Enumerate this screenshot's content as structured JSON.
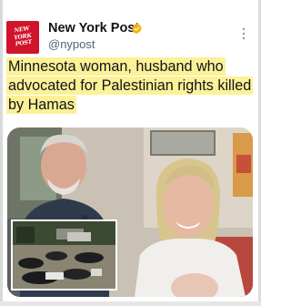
{
  "post": {
    "account_name": "New York Post",
    "handle": "@nypost",
    "avatar_logo_lines": [
      "NEW",
      "YORK",
      "POST"
    ],
    "headline": "Minnesota woman, husband who advocated for Palestinian rights killed by Hamas",
    "verified_badge_color": "#f4b400",
    "headline_highlight_color": "#fcf197",
    "brand_color": "#d0142a"
  },
  "icons": {
    "verified": "verified-badge-icon",
    "more": "more-options-icon"
  }
}
